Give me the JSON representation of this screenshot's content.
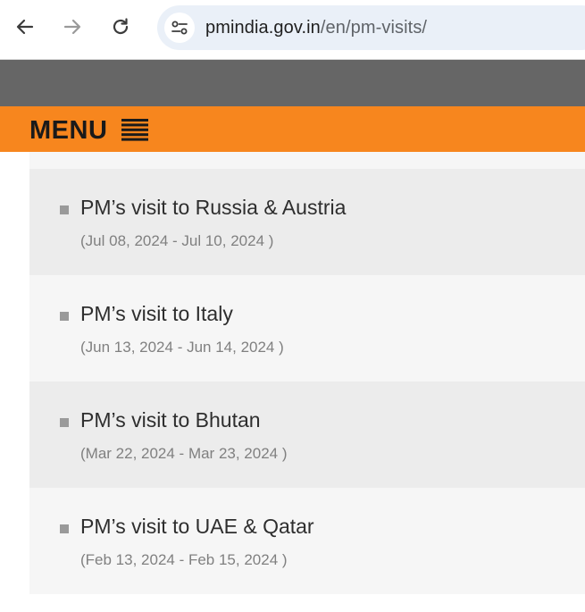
{
  "browser": {
    "back_icon": "arrow-left-icon",
    "forward_icon": "arrow-right-icon",
    "reload_icon": "reload-icon",
    "site_info_icon": "tune-icon",
    "url_host": "pmindia.gov.in",
    "url_path": "/en/pm-visits/"
  },
  "header": {
    "menu_label": "MENU",
    "menu_icon": "hamburger-icon",
    "band_color": "#666666",
    "accent_color": "#f7861e"
  },
  "visits": [
    {
      "title": "PM’s visit to Russia & Austria",
      "dates": "(Jul 08, 2024 - Jul 10, 2024 )"
    },
    {
      "title": "PM’s visit to Italy",
      "dates": "(Jun 13, 2024 - Jun 14, 2024 )"
    },
    {
      "title": "PM’s visit to Bhutan",
      "dates": "(Mar 22, 2024 - Mar 23, 2024 )"
    },
    {
      "title": "PM’s visit to UAE & Qatar",
      "dates": "(Feb 13, 2024 - Feb 15, 2024 )"
    }
  ]
}
